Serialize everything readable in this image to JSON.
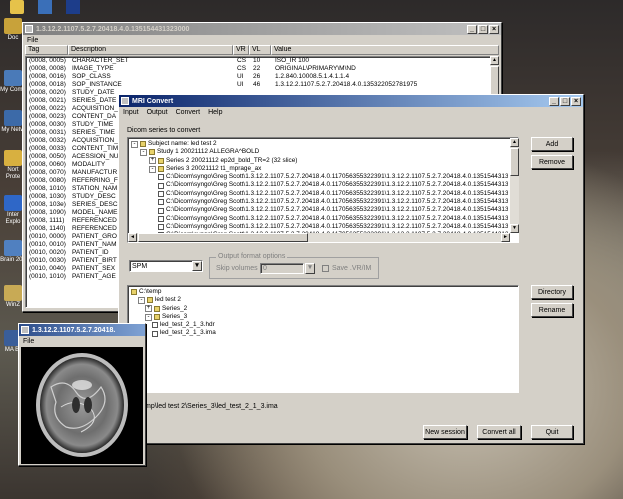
{
  "dicom_window": {
    "title": "1.3.12.2.1107.5.2.7.20418.4.0.135154431323000",
    "menu": [
      "File"
    ],
    "columns": [
      "Tag",
      "Description",
      "VR",
      "VL",
      "Value"
    ],
    "rows": [
      {
        "tag": "(0008, 0005)",
        "desc": "CHARACTER_SET",
        "vr": "CS",
        "vl": "10",
        "val": "ISO_IR 100"
      },
      {
        "tag": "(0008, 0008)",
        "desc": "IMAGE_TYPE",
        "vr": "CS",
        "vl": "22",
        "val": "ORIGINAL\\PRIMARY\\M\\ND"
      },
      {
        "tag": "(0008, 0016)",
        "desc": "SOP_CLASS",
        "vr": "UI",
        "vl": "26",
        "val": "1.2.840.10008.5.1.4.1.1.4"
      },
      {
        "tag": "(0008, 0018)",
        "desc": "SOP_INSTANCE",
        "vr": "UI",
        "vl": "46",
        "val": "1.3.12.2.1107.5.2.7.20418.4.0.135322052781975"
      },
      {
        "tag": "(0008, 0020)",
        "desc": "STUDY_DATE",
        "vr": "",
        "vl": "",
        "val": ""
      },
      {
        "tag": "(0008, 0021)",
        "desc": "SERIES_DATE",
        "vr": "",
        "vl": "",
        "val": ""
      },
      {
        "tag": "(0008, 0022)",
        "desc": "ACQUISITION_",
        "vr": "",
        "vl": "",
        "val": ""
      },
      {
        "tag": "(0008, 0023)",
        "desc": "CONTENT_DA",
        "vr": "",
        "vl": "",
        "val": ""
      },
      {
        "tag": "(0008, 0030)",
        "desc": "STUDY_TIME",
        "vr": "",
        "vl": "",
        "val": ""
      },
      {
        "tag": "(0008, 0031)",
        "desc": "SERIES_TIME",
        "vr": "",
        "vl": "",
        "val": ""
      },
      {
        "tag": "(0008, 0032)",
        "desc": "ACQUISITION_",
        "vr": "",
        "vl": "",
        "val": ""
      },
      {
        "tag": "(0008, 0033)",
        "desc": "CONTENT_TIM",
        "vr": "",
        "vl": "",
        "val": ""
      },
      {
        "tag": "(0008, 0050)",
        "desc": "ACESSION_NU",
        "vr": "",
        "vl": "",
        "val": ""
      },
      {
        "tag": "(0008, 0060)",
        "desc": "MODALITY",
        "vr": "",
        "vl": "",
        "val": ""
      },
      {
        "tag": "(0008, 0070)",
        "desc": "MANUFACTUR",
        "vr": "",
        "vl": "",
        "val": ""
      },
      {
        "tag": "(0008, 0080)",
        "desc": "REFERRING_F",
        "vr": "",
        "vl": "",
        "val": ""
      },
      {
        "tag": "(0008, 1010)",
        "desc": "STATION_NAM",
        "vr": "",
        "vl": "",
        "val": ""
      },
      {
        "tag": "(0008, 1030)",
        "desc": "STUDY_DESC",
        "vr": "",
        "vl": "",
        "val": ""
      },
      {
        "tag": "(0008, 103e)",
        "desc": "SERIES_DESC",
        "vr": "",
        "vl": "",
        "val": ""
      },
      {
        "tag": "(0008, 1090)",
        "desc": "MODEL_NAME",
        "vr": "",
        "vl": "",
        "val": ""
      },
      {
        "tag": "(0008, 1111)",
        "desc": "REFERENCED",
        "vr": "",
        "vl": "",
        "val": ""
      },
      {
        "tag": "(0008, 1140)",
        "desc": "REFERENCED",
        "vr": "",
        "vl": "",
        "val": ""
      },
      {
        "tag": "(0010, 0000)",
        "desc": "PATIENT_GRO",
        "vr": "",
        "vl": "",
        "val": ""
      },
      {
        "tag": "(0010, 0010)",
        "desc": "PATIENT_NAM",
        "vr": "",
        "vl": "",
        "val": ""
      },
      {
        "tag": "(0010, 0020)",
        "desc": "PATIENT_ID",
        "vr": "",
        "vl": "",
        "val": ""
      },
      {
        "tag": "(0010, 0030)",
        "desc": "PATIENT_BIRT",
        "vr": "",
        "vl": "",
        "val": ""
      },
      {
        "tag": "(0010, 0040)",
        "desc": "PATIENT_SEX",
        "vr": "",
        "vl": "",
        "val": ""
      },
      {
        "tag": "(0010, 1010)",
        "desc": "PATIENT_AGE",
        "vr": "",
        "vl": "",
        "val": ""
      }
    ]
  },
  "convert_window": {
    "title": "MRI Convert",
    "menu": [
      "Input",
      "Output",
      "Convert",
      "Help"
    ],
    "series_label": "Dicom series to convert",
    "tree": [
      {
        "level": 0,
        "expander": "-",
        "icon": "folder",
        "text": "Subject name: led test 2"
      },
      {
        "level": 1,
        "expander": "-",
        "icon": "folder",
        "text": "Study 1    20021112    ALLEGRA^BOLD"
      },
      {
        "level": 2,
        "expander": "+",
        "icon": "folder",
        "text": "Series 2   20021112    ep2d_bold_TR=2 (32 slice)"
      },
      {
        "level": 2,
        "expander": "-",
        "icon": "folder",
        "text": "Series 3   20021112    t1_mprage_ax"
      },
      {
        "level": 3,
        "expander": "",
        "icon": "file",
        "text": "C:\\Dicom\\syngo\\Greg Scott\\1.3.12.2.1107.5.2.7.20418.4.0.117056355322391\\1.3.12.2.1107.5.2.7.20418.4.0.1351544313230"
      },
      {
        "level": 3,
        "expander": "",
        "icon": "file",
        "text": "C:\\Dicom\\syngo\\Greg Scott\\1.3.12.2.1107.5.2.7.20418.4.0.117056355322391\\1.3.12.2.1107.5.2.7.20418.4.0.1351544313230"
      },
      {
        "level": 3,
        "expander": "",
        "icon": "file",
        "text": "C:\\Dicom\\syngo\\Greg Scott\\1.3.12.2.1107.5.2.7.20418.4.0.117056355322391\\1.3.12.2.1107.5.2.7.20418.4.0.1351544313230"
      },
      {
        "level": 3,
        "expander": "",
        "icon": "file",
        "text": "C:\\Dicom\\syngo\\Greg Scott\\1.3.12.2.1107.5.2.7.20418.4.0.117056355322391\\1.3.12.2.1107.5.2.7.20418.4.0.1351544313230"
      },
      {
        "level": 3,
        "expander": "",
        "icon": "file",
        "text": "C:\\Dicom\\syngo\\Greg Scott\\1.3.12.2.1107.5.2.7.20418.4.0.117056355322391\\1.3.12.2.1107.5.2.7.20418.4.0.1351544313230"
      },
      {
        "level": 3,
        "expander": "",
        "icon": "file",
        "text": "C:\\Dicom\\syngo\\Greg Scott\\1.3.12.2.1107.5.2.7.20418.4.0.117056355322391\\1.3.12.2.1107.5.2.7.20418.4.0.1351544313230"
      },
      {
        "level": 3,
        "expander": "",
        "icon": "file",
        "text": "C:\\Dicom\\syngo\\Greg Scott\\1.3.12.2.1107.5.2.7.20418.4.0.117056355322391\\1.3.12.2.1107.5.2.7.20418.4.0.1351544313230"
      },
      {
        "level": 3,
        "expander": "",
        "icon": "file",
        "text": "C:\\Dicom\\syngo\\Greg Scott\\1.3.12.2.1107.5.2.7.20418.4.0.117056355322391\\1.3.12.2.1107.5.2.7.20418.4.0.1351544313230"
      }
    ],
    "add_button": "Add",
    "remove_button": "Remove",
    "format_select": "SPM",
    "output_options": {
      "legend": "Output format options",
      "skip_label": "Skip volumes",
      "skip_value": "0",
      "save_label": "Save .VR/IM"
    },
    "output_tree": [
      {
        "level": 0,
        "expander": "",
        "icon": "folder",
        "text": "C:\\temp"
      },
      {
        "level": 1,
        "expander": "-",
        "icon": "folder",
        "text": "led test 2"
      },
      {
        "level": 2,
        "expander": "+",
        "icon": "folder",
        "text": "Series_2"
      },
      {
        "level": 2,
        "expander": "-",
        "icon": "folder",
        "text": "Series_3"
      },
      {
        "level": 3,
        "expander": "",
        "icon": "file",
        "text": "led_test_2_1_3.hdr"
      },
      {
        "level": 3,
        "expander": "",
        "icon": "file",
        "text": "led_test_2_1_3.ima"
      }
    ],
    "directory_button": "Directory",
    "rename_button": "Rename",
    "status_path": "mp\\led test 2\\Series_3\\led_test_2_1_3.ima",
    "new_session_button": "New session",
    "convert_all_button": "Convert all",
    "quit_button": "Quit"
  },
  "image_window": {
    "title": "1.3.12.2.1107.5.2.7.20418.",
    "menu": [
      "File"
    ]
  },
  "desktop": {
    "icons": [
      "Doc",
      "My Comp",
      "My Netw",
      "Nort Prote",
      "Inter Explo",
      "Brain 200",
      "WinZ",
      "MA Br"
    ]
  }
}
